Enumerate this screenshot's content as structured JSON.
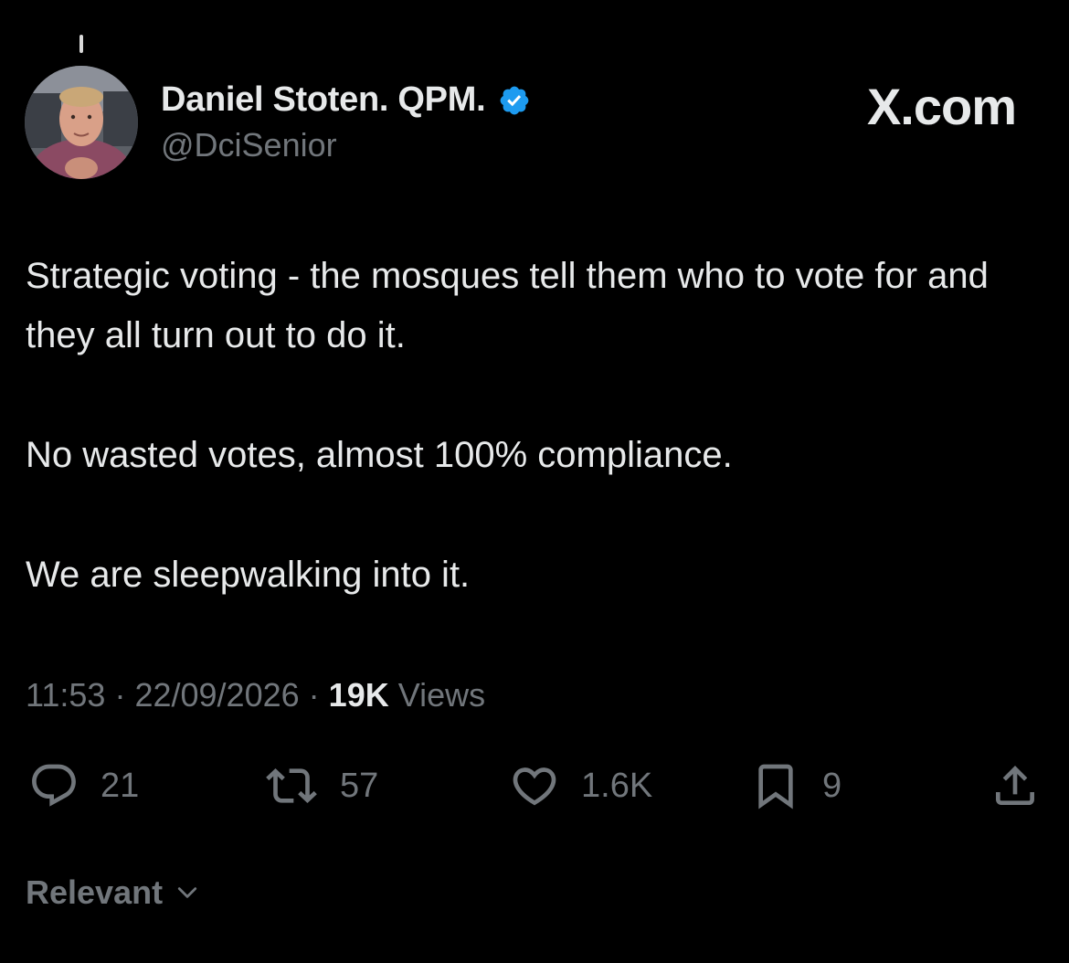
{
  "author": {
    "display_name": "Daniel Stoten. QPM.",
    "handle": "@DciSenior",
    "verified": true
  },
  "site_mark": "X.com",
  "tweet": {
    "paragraphs": [
      "Strategic voting - the mosques tell them who to vote for and they all turn out to do it.",
      "No wasted votes, almost 100% compliance.",
      "We are sleepwalking into it."
    ]
  },
  "meta": {
    "time": "11:53",
    "separator": "·",
    "date": "22/09/2026",
    "views_count": "19K",
    "views_label": "Views"
  },
  "actions": {
    "replies": "21",
    "reposts": "57",
    "likes": "1.6K",
    "bookmarks": "9"
  },
  "sort": {
    "label": "Relevant"
  },
  "colors": {
    "background": "#000000",
    "text_primary": "#e7e9ea",
    "text_secondary": "#71767b",
    "verified_blue": "#1d9bf0"
  },
  "icons": {
    "reply": "reply-icon",
    "repost": "repost-icon",
    "like": "heart-icon",
    "bookmark": "bookmark-icon",
    "share": "share-icon",
    "verified": "verified-badge-icon",
    "sort": "chevron-down-icon"
  }
}
